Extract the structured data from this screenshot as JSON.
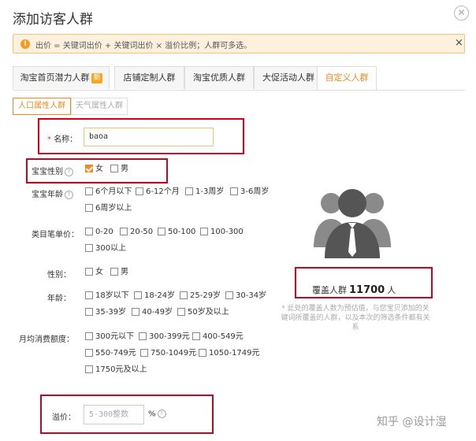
{
  "dialog": {
    "title": "添加访客人群",
    "close_icon": "close-icon"
  },
  "alert": {
    "text": "出价 = 关键词出价 + 关键词出价 × 溢价比例；人群可多选。",
    "close": "×"
  },
  "tabs": [
    {
      "label": "淘宝首页潜力人群",
      "badge": "新"
    },
    {
      "label": "店铺定制人群"
    },
    {
      "label": "淘宝优质人群"
    },
    {
      "label": "大促活动人群"
    },
    {
      "label": "自定义人群",
      "active": true
    }
  ],
  "subtabs": [
    {
      "label": "人口属性人群",
      "active": true
    },
    {
      "label": "天气属性人群"
    }
  ],
  "form": {
    "name": {
      "label": "名称：",
      "required": "*",
      "value": "baoa"
    },
    "baby_gender": {
      "label": "宝宝性别",
      "options": [
        {
          "label": "女",
          "checked": true
        },
        {
          "label": "男",
          "checked": false
        }
      ]
    },
    "baby_age": {
      "label": "宝宝年龄",
      "options": [
        "6个月以下",
        "6-12个月",
        "1-3周岁",
        "3-6周岁",
        "6周岁以上"
      ]
    },
    "price": {
      "label": "类目笔单价：",
      "options": [
        "0-20",
        "20-50",
        "50-100",
        "100-300",
        "300以上"
      ]
    },
    "gender": {
      "label": "性别：",
      "options": [
        "女",
        "男"
      ]
    },
    "age": {
      "label": "年龄：",
      "options": [
        "18岁以下",
        "18-24岁",
        "25-29岁",
        "30-34岁",
        "35-39岁",
        "40-49岁",
        "50岁及以上"
      ]
    },
    "spend": {
      "label": "月均消费额度：",
      "options": [
        "300元以下",
        "300-399元",
        "400-549元",
        "550-749元",
        "750-1049元",
        "1050-1749元",
        "1750元及以上"
      ]
    },
    "premium": {
      "label": "溢价：",
      "placeholder": "5-300整数",
      "unit": "%"
    }
  },
  "coverage": {
    "prefix": "覆盖人群",
    "count": "11700",
    "suffix": "人",
    "note": "* 此处的覆盖人数为预估值，与您宝贝添加的关键词所覆盖的人群，以及本次的筛选条件都有关系"
  },
  "watermark": "知乎 @设计湿",
  "colors": {
    "accent": "#f08a24",
    "highlight": "#d0021b",
    "alert_bg": "#fdf1de"
  }
}
